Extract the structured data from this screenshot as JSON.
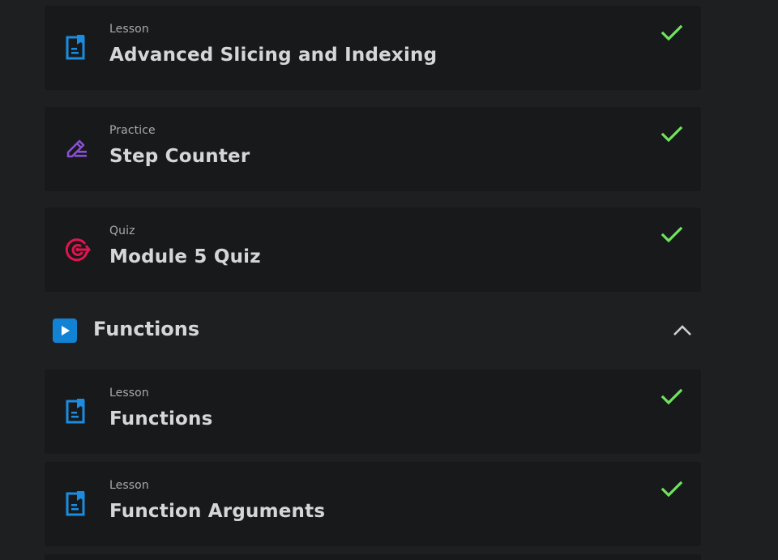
{
  "colors": {
    "background": "#1e1f21",
    "card": "#18191b",
    "lesson_icon": "#1a8de0",
    "practice_icon": "#8a4fd6",
    "quiz_icon": "#e0144f",
    "check": "#6ee55a",
    "module_play": "#1283d4"
  },
  "items_top": [
    {
      "type": "Lesson",
      "title": "Advanced Slicing and Indexing",
      "icon": "lesson-doc-icon",
      "completed": true
    },
    {
      "type": "Practice",
      "title": "Step Counter",
      "icon": "pencil-icon",
      "completed": true
    },
    {
      "type": "Quiz",
      "title": "Module 5 Quiz",
      "icon": "target-icon",
      "completed": true
    }
  ],
  "module": {
    "title": "Functions",
    "icon": "play-icon",
    "toggle_icon": "chevron-up-icon",
    "expanded": true
  },
  "items_module": [
    {
      "type": "Lesson",
      "title": "Functions",
      "icon": "lesson-doc-icon",
      "completed": true
    },
    {
      "type": "Lesson",
      "title": "Function Arguments",
      "icon": "lesson-doc-icon",
      "completed": true
    }
  ]
}
